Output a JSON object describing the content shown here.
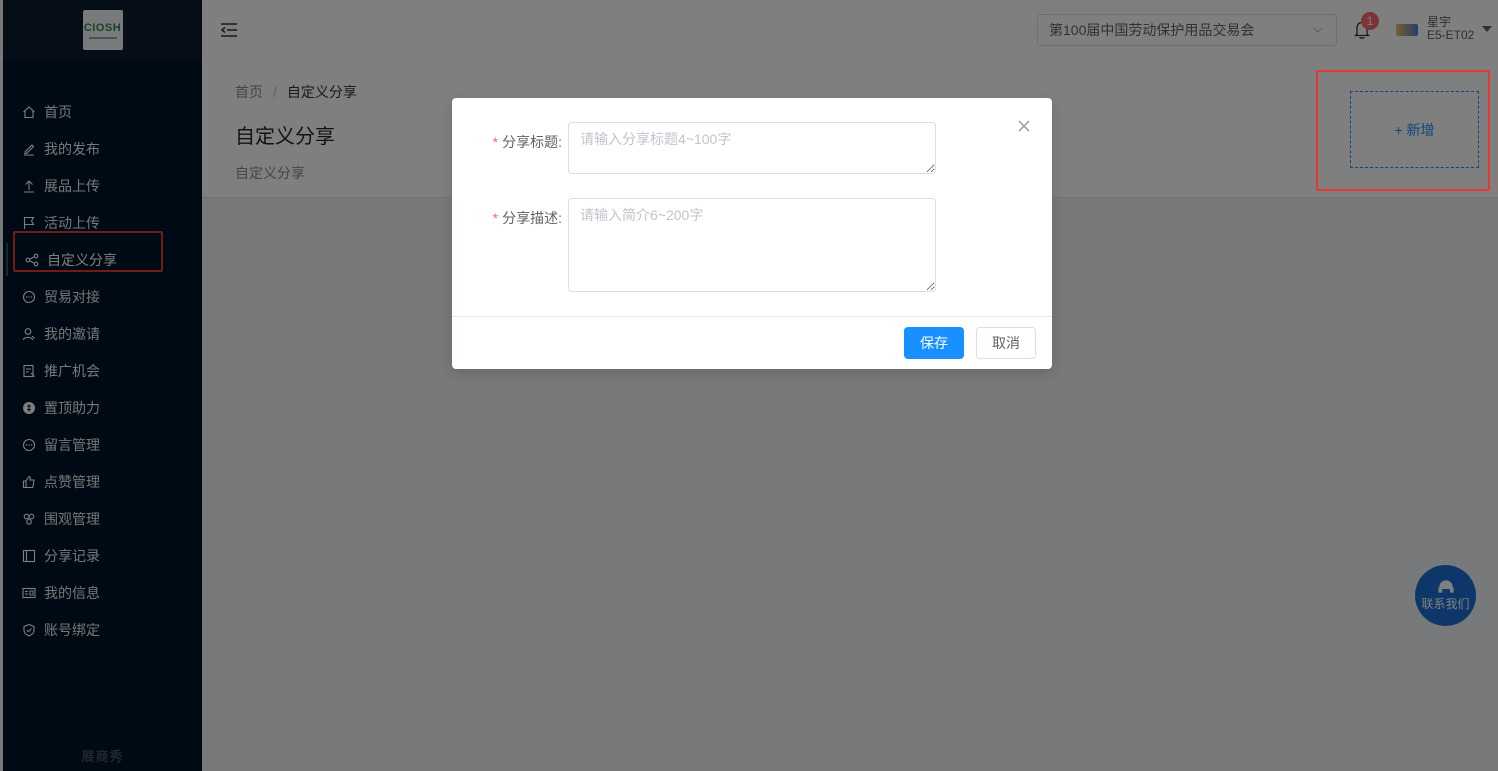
{
  "sidebar": {
    "logo_text": "CIOSH",
    "items": [
      {
        "label": "首页",
        "icon": "home-icon"
      },
      {
        "label": "我的发布",
        "icon": "edit-icon"
      },
      {
        "label": "展品上传",
        "icon": "upload-icon"
      },
      {
        "label": "活动上传",
        "icon": "flag-icon"
      },
      {
        "label": "自定义分享",
        "icon": "share-icon"
      },
      {
        "label": "贸易对接",
        "icon": "chat-icon"
      },
      {
        "label": "我的邀请",
        "icon": "user-invite-icon"
      },
      {
        "label": "推广机会",
        "icon": "promo-icon"
      },
      {
        "label": "置顶助力",
        "icon": "coin-icon"
      },
      {
        "label": "留言管理",
        "icon": "message-icon"
      },
      {
        "label": "点赞管理",
        "icon": "thumb-up-icon"
      },
      {
        "label": "围观管理",
        "icon": "group-icon"
      },
      {
        "label": "分享记录",
        "icon": "record-icon"
      },
      {
        "label": "我的信息",
        "icon": "id-card-icon"
      },
      {
        "label": "账号绑定",
        "icon": "shield-icon"
      }
    ],
    "active_index": 4,
    "footer": "展商秀"
  },
  "header": {
    "expo_select": "第100届中国劳动保护用品交易会",
    "notification_count": "1",
    "user_name": "星宇",
    "user_booth": "E5-ET02"
  },
  "page": {
    "breadcrumb": [
      "首页",
      "自定义分享"
    ],
    "breadcrumb_sep": "/",
    "title": "自定义分享",
    "subtitle": "自定义分享",
    "add_button": "+ 新增"
  },
  "dialog": {
    "title_label": "分享标题:",
    "title_placeholder": "请输入分享标题4~100字",
    "desc_label": "分享描述:",
    "desc_placeholder": "请输入简介6~200字",
    "required_mark": "*",
    "save": "保存",
    "cancel": "取消"
  },
  "contact": {
    "label": "联系我们"
  },
  "colors": {
    "primary": "#1890ff",
    "sidebar": "#001529",
    "highlight": "#e53935"
  }
}
